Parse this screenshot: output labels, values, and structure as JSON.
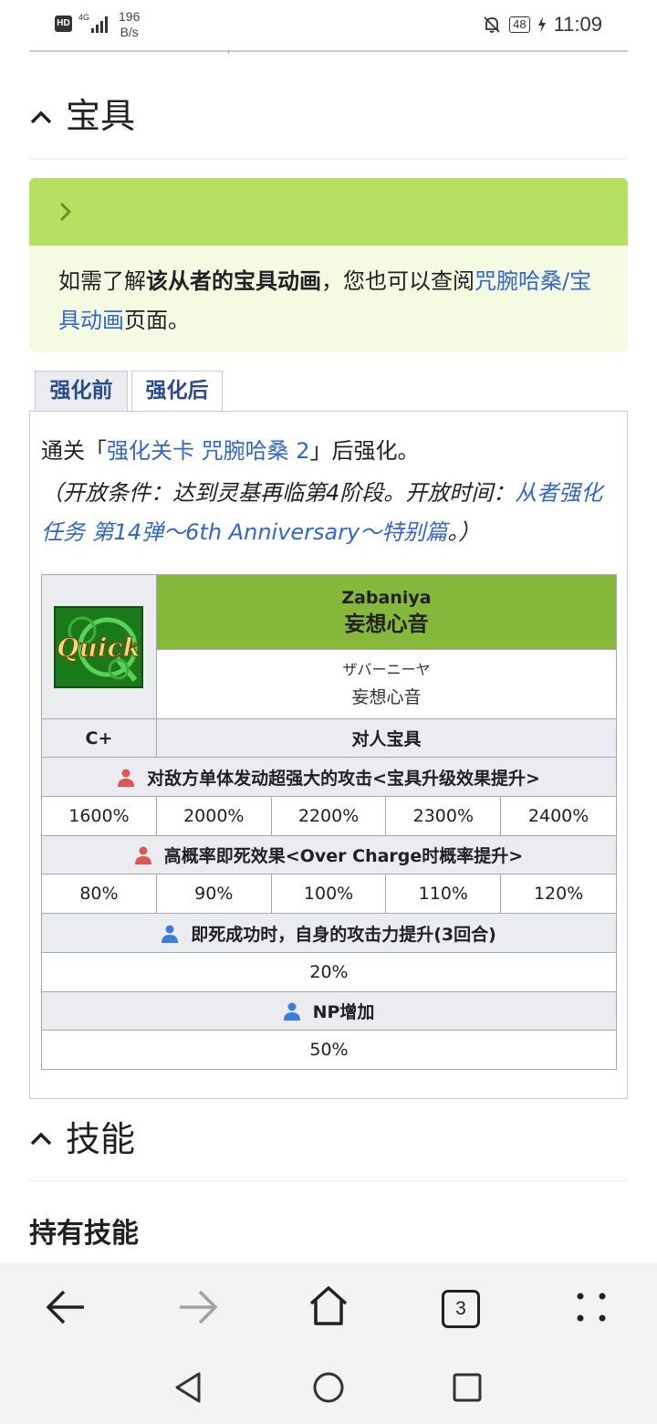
{
  "status_bar": {
    "hd": "HD",
    "network": "4G",
    "speed_value": "196",
    "speed_unit": "B/s",
    "battery": "48",
    "time": "11:09"
  },
  "sections": {
    "noble_phantasm_title": "宝具",
    "skills_title": "技能",
    "owned_skills": "持有技能"
  },
  "notice": {
    "prefix": "如需了解",
    "bold": "该从者的宝具动画",
    "middle": "，您也可以查阅",
    "link": "咒腕哈桑/宝具动画",
    "suffix": "页面。"
  },
  "tabs": [
    "强化前",
    "强化后"
  ],
  "panel": {
    "line1_prefix": "通关「",
    "line1_link": "强化关卡 咒腕哈桑 2",
    "line1_suffix": "」后强化。",
    "line2_prefix": "（开放条件：达到灵基再临第4阶段。开放时间：",
    "line2_link": "从者强化任务 第14弹～6th Anniversary～特别篇",
    "line2_suffix": "。）"
  },
  "np": {
    "card": "Quick",
    "name_en": "Zabaniya",
    "name_zh": "妄想心音",
    "ruby_jp": "ザバーニーヤ",
    "ruby_zh": "妄想心音",
    "rank": "C+",
    "type": "对人宝具",
    "effects": [
      {
        "icon": "red",
        "label": "对敌方单体发动超强大的攻击<宝具升级效果提升>",
        "values": [
          "1600%",
          "2000%",
          "2200%",
          "2300%",
          "2400%"
        ]
      },
      {
        "icon": "red",
        "label": "高概率即死效果<Over Charge时概率提升>",
        "values": [
          "80%",
          "90%",
          "100%",
          "110%",
          "120%"
        ]
      },
      {
        "icon": "blue",
        "label": "即死成功时，自身的攻击力提升(3回合)",
        "values": [
          "20%"
        ]
      },
      {
        "icon": "blue",
        "label": "NP增加",
        "values": [
          "50%"
        ]
      }
    ]
  },
  "navbar": {
    "tab_count": "3"
  },
  "colors": {
    "notice_bar": "#b5e061",
    "notice_bg": "#f5fbe3",
    "np_header": "#86b83b",
    "link": "#3366cc",
    "enemy_icon": "#dd5555",
    "self_icon": "#3b7ddd"
  }
}
